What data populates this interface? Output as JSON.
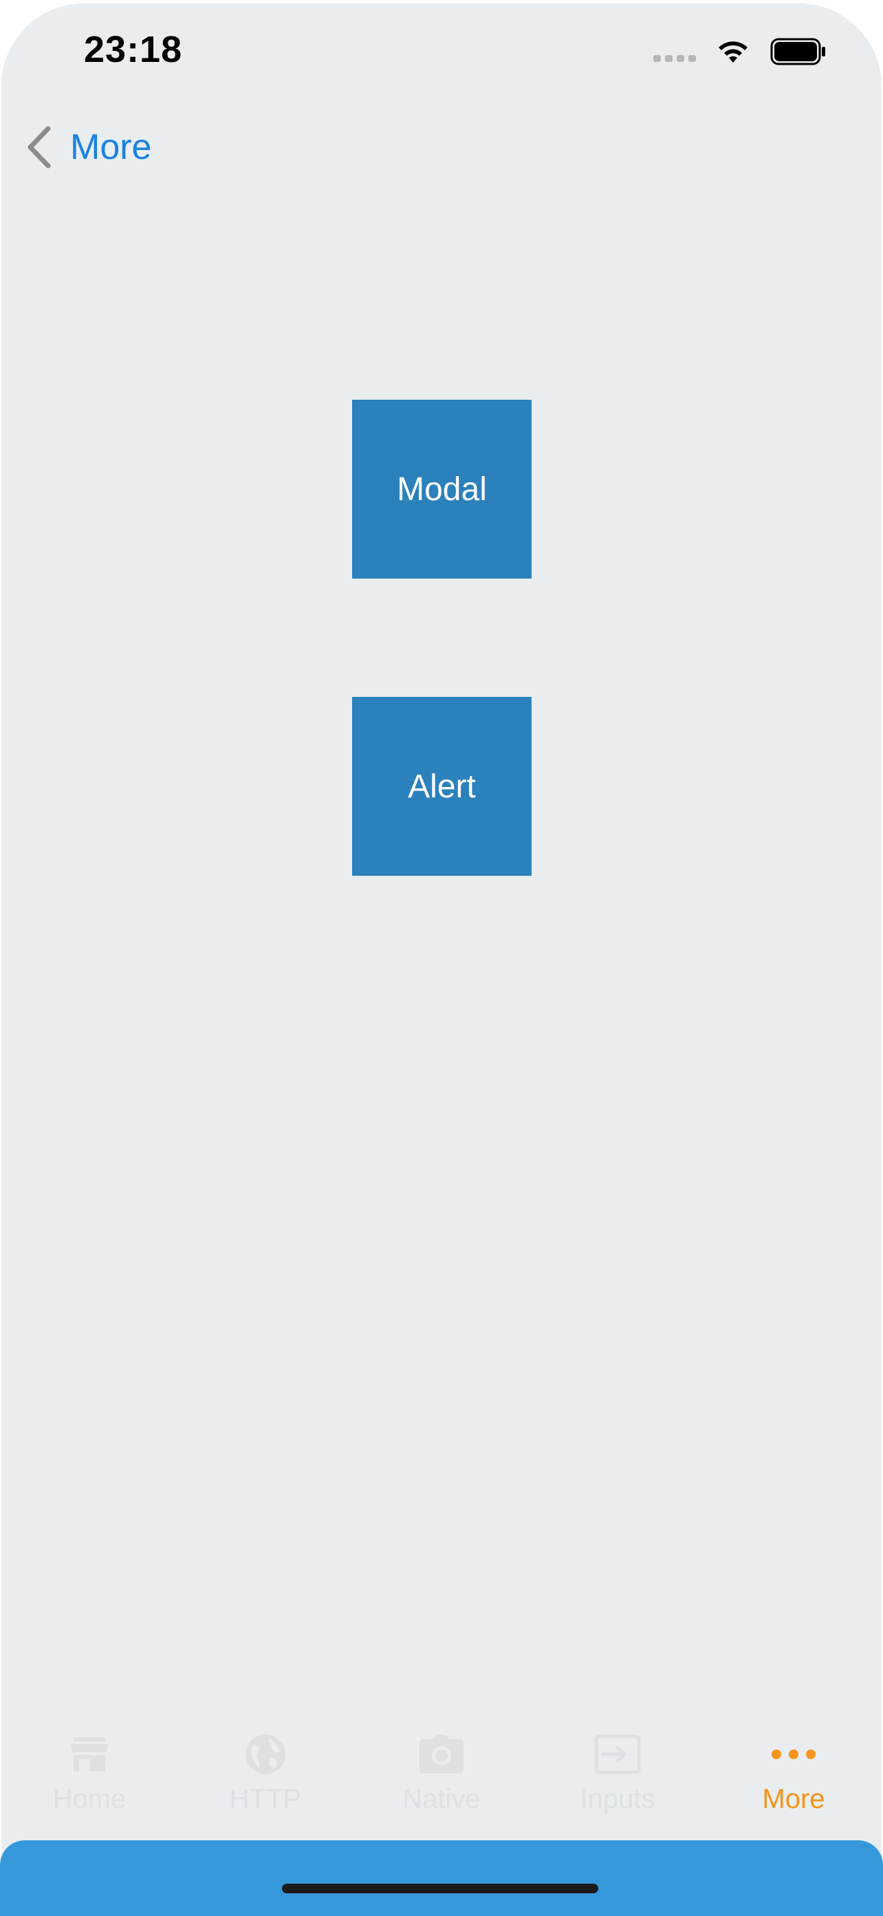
{
  "status_bar": {
    "time": "23:18",
    "signal_icon": "cellular-signal-icon",
    "wifi_icon": "wifi-icon",
    "battery_icon": "battery-icon"
  },
  "nav": {
    "back_label": "More",
    "back_icon": "chevron-left-icon"
  },
  "content": {
    "modal_label": "Modal",
    "alert_label": "Alert"
  },
  "tabs": [
    {
      "label": "Home",
      "icon": "store-icon",
      "active": false
    },
    {
      "label": "HTTP",
      "icon": "globe-icon",
      "active": false
    },
    {
      "label": "Native",
      "icon": "camera-icon",
      "active": false
    },
    {
      "label": "Inputs",
      "icon": "input-icon",
      "active": false
    },
    {
      "label": "More",
      "icon": "more-dots-icon",
      "active": true
    }
  ],
  "colors": {
    "background": "#e9edef",
    "accent_blue": "#1a82e2",
    "button_blue": "#2b81bc",
    "active_tab": "#f7941d",
    "inactive_tab": "#dde1e4",
    "bottom_panel": "#3598db"
  }
}
